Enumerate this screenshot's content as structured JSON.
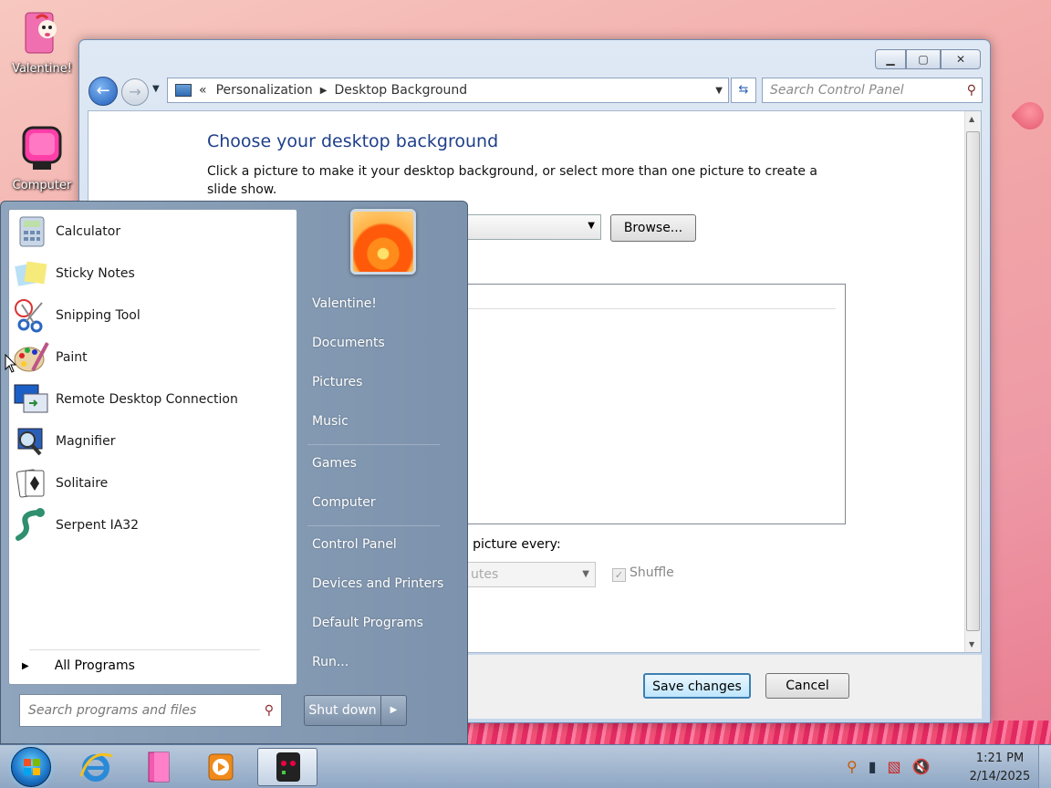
{
  "desktop": {
    "icons": [
      {
        "label": "Valentine!"
      },
      {
        "label": "Computer"
      }
    ]
  },
  "window": {
    "caption_buttons": {
      "minimize": "▁",
      "maximize": "▢",
      "close": "✕"
    },
    "address": {
      "chevron": "«",
      "crumbs": [
        "Personalization",
        "Desktop Background"
      ]
    },
    "search_placeholder": "Search Control Panel",
    "content": {
      "title": "Choose your desktop background",
      "description": "Click a picture to make it your desktop background, or select more than one picture to create a slide show.",
      "browse_label": "Browse...",
      "change_picture_label": "e picture every:",
      "interval_value": "utes",
      "shuffle_label": "Shuffle",
      "shuffle_checked": true
    },
    "footer": {
      "save_label": "Save changes",
      "cancel_label": "Cancel"
    }
  },
  "start_menu": {
    "programs": [
      {
        "name": "Calculator",
        "icon": "calculator-icon"
      },
      {
        "name": "Sticky Notes",
        "icon": "sticky-notes-icon"
      },
      {
        "name": "Snipping Tool",
        "icon": "snipping-tool-icon"
      },
      {
        "name": "Paint",
        "icon": "paint-icon"
      },
      {
        "name": "Remote Desktop Connection",
        "icon": "remote-desktop-icon"
      },
      {
        "name": "Magnifier",
        "icon": "magnifier-icon"
      },
      {
        "name": "Solitaire",
        "icon": "solitaire-icon"
      },
      {
        "name": "Serpent IA32",
        "icon": "serpent-icon"
      }
    ],
    "all_programs_label": "All Programs",
    "search_placeholder": "Search programs and files",
    "right_items": [
      {
        "label": "Valentine!"
      },
      {
        "label": "Documents"
      },
      {
        "label": "Pictures"
      },
      {
        "label": "Music"
      },
      {
        "label": "Games"
      },
      {
        "label": "Computer"
      },
      {
        "label": "Control Panel"
      },
      {
        "label": "Devices and Printers"
      },
      {
        "label": "Default Programs"
      },
      {
        "label": "Run..."
      }
    ],
    "shutdown_label": "Shut down"
  },
  "taskbar": {
    "pinned": [
      "internet-explorer-icon",
      "documents-icon",
      "media-player-icon",
      "serpent-app-icon"
    ],
    "clock": {
      "time": "1:21 PM",
      "date": "2/14/2025"
    }
  },
  "colors": {
    "accent": "#1e3f8a",
    "title_text": "#1e3f8a",
    "desktop_pink": "#f2a8a8"
  }
}
